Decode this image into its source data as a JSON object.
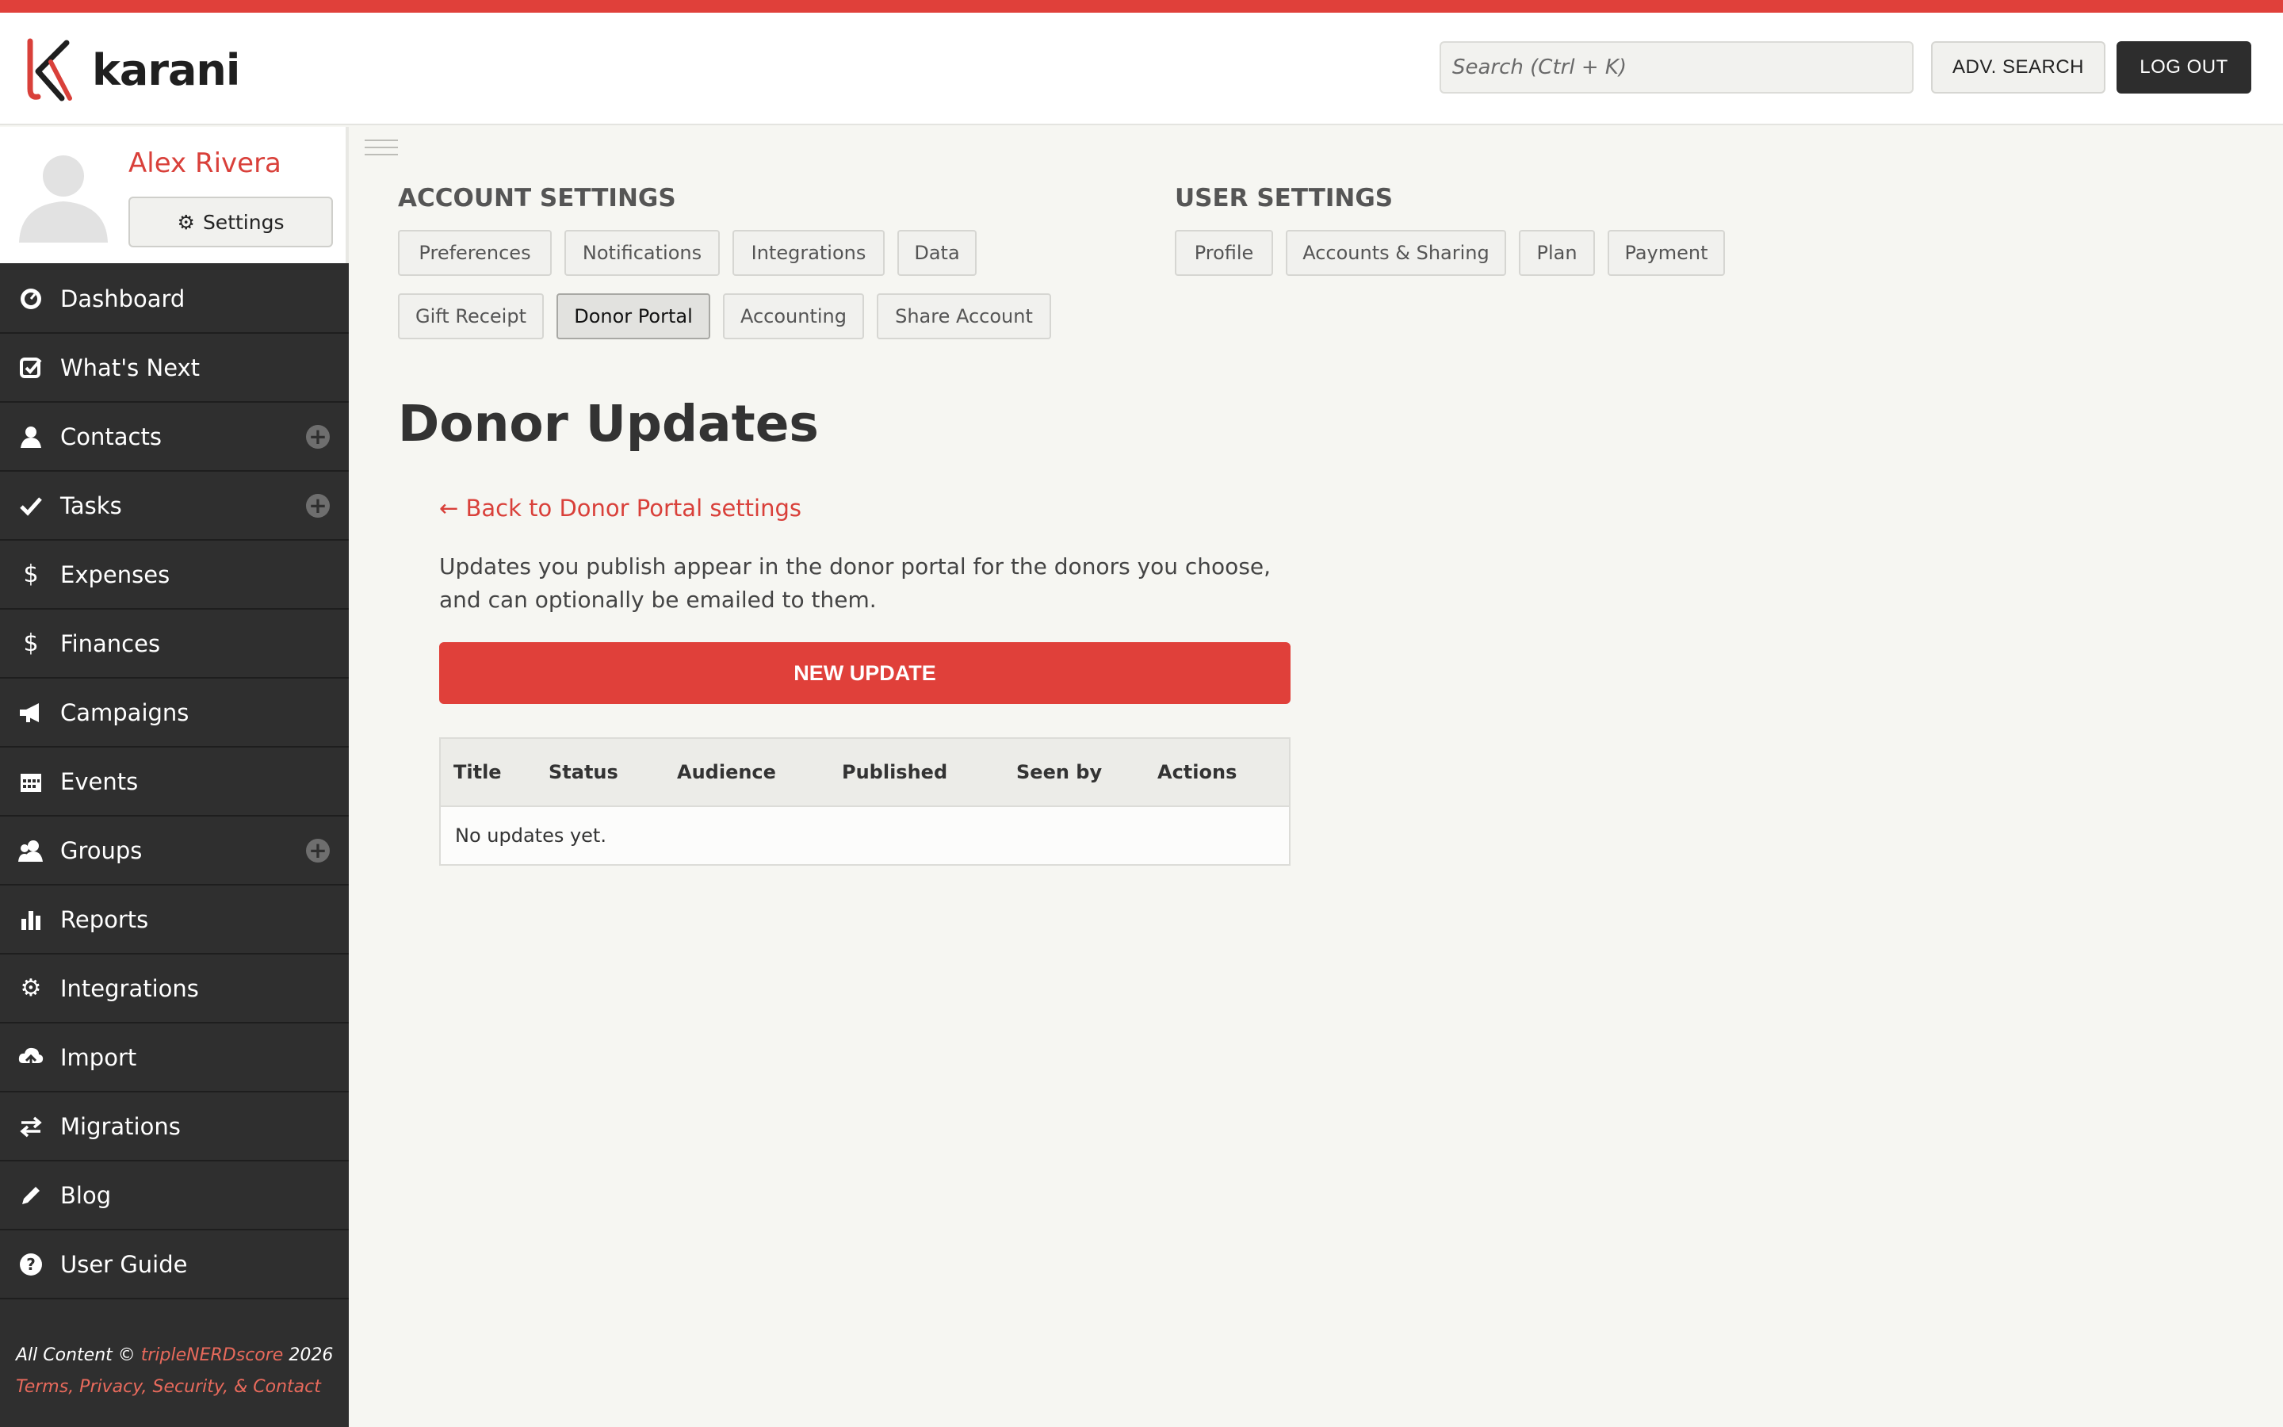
{
  "app": {
    "name": "karani",
    "accent": "#e0403a"
  },
  "header": {
    "search_placeholder": "Search (Ctrl + K)",
    "adv_search_label": "ADV. SEARCH",
    "logout_label": "LOG OUT"
  },
  "profile": {
    "name": "Alex Rivera",
    "settings_label": "Settings"
  },
  "nav": [
    {
      "label": "Dashboard",
      "icon": "dashboard-icon"
    },
    {
      "label": "What's Next",
      "icon": "check-square-icon"
    },
    {
      "label": "Contacts",
      "icon": "user-icon"
    },
    {
      "label": "Tasks",
      "icon": "check-icon"
    },
    {
      "label": "Expenses",
      "icon": "dollar-icon"
    },
    {
      "label": "Finances",
      "icon": "dollar-icon"
    },
    {
      "label": "Campaigns",
      "icon": "megaphone-icon"
    },
    {
      "label": "Events",
      "icon": "calendar-icon"
    },
    {
      "label": "Groups",
      "icon": "users-icon"
    },
    {
      "label": "Reports",
      "icon": "bar-chart-icon"
    },
    {
      "label": "Integrations",
      "icon": "gear-icon"
    },
    {
      "label": "Import",
      "icon": "cloud-upload-icon"
    },
    {
      "label": "Migrations",
      "icon": "arrows-icon"
    },
    {
      "label": "Blog",
      "icon": "pencil-icon"
    },
    {
      "label": "User Guide",
      "icon": "question-icon"
    }
  ],
  "footer": {
    "prefix": "All Content © ",
    "company": "tripleNERDscore",
    "year": " 2026",
    "links": "Terms, Privacy, Security, & Contact"
  },
  "account_settings": {
    "title": "ACCOUNT SETTINGS",
    "tabs": [
      "Preferences",
      "Notifications",
      "Integrations",
      "Data",
      "Gift Receipt",
      "Donor Portal",
      "Accounting",
      "Share Account"
    ],
    "active": "Donor Portal"
  },
  "user_settings": {
    "title": "USER SETTINGS",
    "tabs": [
      "Profile",
      "Accounts & Sharing",
      "Plan",
      "Payment"
    ]
  },
  "main": {
    "title": "Donor Updates",
    "back_link": "← Back to Donor Portal settings",
    "intro": "Updates you publish appear in the donor portal for the donors you choose, and can optionally be emailed to them.",
    "new_button": "NEW UPDATE",
    "table": {
      "columns": [
        "Title",
        "Status",
        "Audience",
        "Published",
        "Seen by",
        "Actions"
      ],
      "empty_text": "No updates yet."
    }
  }
}
